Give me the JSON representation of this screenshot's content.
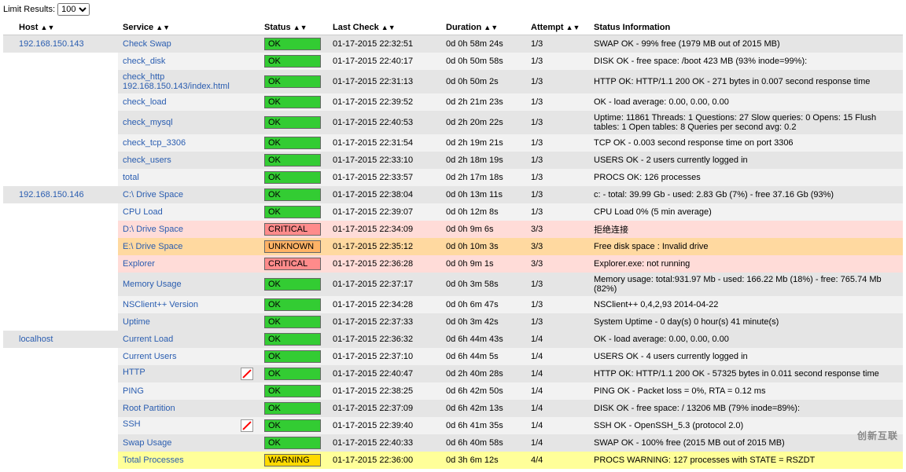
{
  "limit_label": "Limit Results:",
  "limit_value": "100",
  "headers": {
    "host": "Host",
    "service": "Service",
    "status": "Status",
    "last_check": "Last Check",
    "duration": "Duration",
    "attempt": "Attempt",
    "status_info": "Status Information"
  },
  "hosts": [
    {
      "name": "192.168.150.143",
      "services": [
        {
          "name": "Check Swap",
          "status": "OK",
          "last_check": "01-17-2015 22:32:51",
          "duration": "0d 0h 58m 24s",
          "attempt": "1/3",
          "info": "SWAP OK - 99% free (1979 MB out of 2015 MB)",
          "row": "even"
        },
        {
          "name": "check_disk",
          "status": "OK",
          "last_check": "01-17-2015 22:40:17",
          "duration": "0d 0h 50m 58s",
          "attempt": "1/3",
          "info": "DISK OK - free space: /boot 423 MB (93% inode=99%):",
          "row": "odd"
        },
        {
          "name": "check_http 192.168.150.143/index.html",
          "status": "OK",
          "last_check": "01-17-2015 22:31:13",
          "duration": "0d 0h 50m 2s",
          "attempt": "1/3",
          "info": "HTTP OK: HTTP/1.1 200 OK - 271 bytes in 0.007 second response time",
          "row": "even"
        },
        {
          "name": "check_load",
          "status": "OK",
          "last_check": "01-17-2015 22:39:52",
          "duration": "0d 2h 21m 23s",
          "attempt": "1/3",
          "info": "OK - load average: 0.00, 0.00, 0.00",
          "row": "odd"
        },
        {
          "name": "check_mysql",
          "status": "OK",
          "last_check": "01-17-2015 22:40:53",
          "duration": "0d 2h 20m 22s",
          "attempt": "1/3",
          "info": "Uptime: 11861 Threads: 1 Questions: 27 Slow queries: 0 Opens: 15 Flush tables: 1 Open tables: 8 Queries per second avg: 0.2",
          "row": "even"
        },
        {
          "name": "check_tcp_3306",
          "status": "OK",
          "last_check": "01-17-2015 22:31:54",
          "duration": "0d 2h 19m 21s",
          "attempt": "1/3",
          "info": "TCP OK - 0.003 second response time on port 3306",
          "row": "odd"
        },
        {
          "name": "check_users",
          "status": "OK",
          "last_check": "01-17-2015 22:33:10",
          "duration": "0d 2h 18m 19s",
          "attempt": "1/3",
          "info": "USERS OK - 2 users currently logged in",
          "row": "even"
        },
        {
          "name": "total",
          "status": "OK",
          "last_check": "01-17-2015 22:33:57",
          "duration": "0d 2h 17m 18s",
          "attempt": "1/3",
          "info": "PROCS OK: 126 processes",
          "row": "odd"
        }
      ]
    },
    {
      "name": "192.168.150.146",
      "services": [
        {
          "name": "C:\\ Drive Space",
          "status": "OK",
          "last_check": "01-17-2015 22:38:04",
          "duration": "0d 0h 13m 11s",
          "attempt": "1/3",
          "info": "c: - total: 39.99 Gb - used: 2.83 Gb (7%) - free 37.16 Gb (93%)",
          "row": "even"
        },
        {
          "name": "CPU Load",
          "status": "OK",
          "last_check": "01-17-2015 22:39:07",
          "duration": "0d 0h 12m 8s",
          "attempt": "1/3",
          "info": "CPU Load 0% (5 min average)",
          "row": "odd"
        },
        {
          "name": "D:\\ Drive Space",
          "status": "CRITICAL",
          "last_check": "01-17-2015 22:34:09",
          "duration": "0d 0h 9m 6s",
          "attempt": "3/3",
          "info": "拒绝连接",
          "row": "crit"
        },
        {
          "name": "E:\\ Drive Space",
          "status": "UNKNOWN",
          "last_check": "01-17-2015 22:35:12",
          "duration": "0d 0h 10m 3s",
          "attempt": "3/3",
          "info": "Free disk space : Invalid drive",
          "row": "unk"
        },
        {
          "name": "Explorer",
          "status": "CRITICAL",
          "last_check": "01-17-2015 22:36:28",
          "duration": "0d 0h 9m 1s",
          "attempt": "3/3",
          "info": "Explorer.exe: not running",
          "row": "crit"
        },
        {
          "name": "Memory Usage",
          "status": "OK",
          "last_check": "01-17-2015 22:37:17",
          "duration": "0d 0h 3m 58s",
          "attempt": "1/3",
          "info": "Memory usage: total:931.97 Mb - used: 166.22 Mb (18%) - free: 765.74 Mb (82%)",
          "row": "even"
        },
        {
          "name": "NSClient++ Version",
          "status": "OK",
          "last_check": "01-17-2015 22:34:28",
          "duration": "0d 0h 6m 47s",
          "attempt": "1/3",
          "info": "NSClient++ 0,4,2,93 2014-04-22",
          "row": "odd"
        },
        {
          "name": "Uptime",
          "status": "OK",
          "last_check": "01-17-2015 22:37:33",
          "duration": "0d 0h 3m 42s",
          "attempt": "1/3",
          "info": "System Uptime - 0 day(s) 0 hour(s) 41 minute(s)",
          "row": "even"
        }
      ]
    },
    {
      "name": "localhost",
      "services": [
        {
          "name": "Current Load",
          "status": "OK",
          "last_check": "01-17-2015 22:36:32",
          "duration": "0d 6h 44m 43s",
          "attempt": "1/4",
          "info": "OK - load average: 0.00, 0.00, 0.00",
          "row": "even"
        },
        {
          "name": "Current Users",
          "status": "OK",
          "last_check": "01-17-2015 22:37:10",
          "duration": "0d 6h 44m 5s",
          "attempt": "1/4",
          "info": "USERS OK - 4 users currently logged in",
          "row": "odd"
        },
        {
          "name": "HTTP",
          "status": "OK",
          "last_check": "01-17-2015 22:40:47",
          "duration": "0d 2h 40m 28s",
          "attempt": "1/4",
          "info": "HTTP OK: HTTP/1.1 200 OK - 57325 bytes in 0.011 second response time",
          "row": "even",
          "flag": true
        },
        {
          "name": "PING",
          "status": "OK",
          "last_check": "01-17-2015 22:38:25",
          "duration": "0d 6h 42m 50s",
          "attempt": "1/4",
          "info": "PING OK - Packet loss = 0%, RTA = 0.12 ms",
          "row": "odd"
        },
        {
          "name": "Root Partition",
          "status": "OK",
          "last_check": "01-17-2015 22:37:09",
          "duration": "0d 6h 42m 13s",
          "attempt": "1/4",
          "info": "DISK OK - free space: / 13206 MB (79% inode=89%):",
          "row": "even"
        },
        {
          "name": "SSH",
          "status": "OK",
          "last_check": "01-17-2015 22:39:40",
          "duration": "0d 6h 41m 35s",
          "attempt": "1/4",
          "info": "SSH OK - OpenSSH_5.3 (protocol 2.0)",
          "row": "odd",
          "flag": true
        },
        {
          "name": "Swap Usage",
          "status": "OK",
          "last_check": "01-17-2015 22:40:33",
          "duration": "0d 6h 40m 58s",
          "attempt": "1/4",
          "info": "SWAP OK - 100% free (2015 MB out of 2015 MB)",
          "row": "even"
        },
        {
          "name": "Total Processes",
          "status": "WARNING",
          "last_check": "01-17-2015 22:36:00",
          "duration": "0d 3h 6m 12s",
          "attempt": "4/4",
          "info": "PROCS WARNING: 127 processes with STATE = RSZDT",
          "row": "warn"
        }
      ]
    }
  ],
  "watermark": "创新互联"
}
